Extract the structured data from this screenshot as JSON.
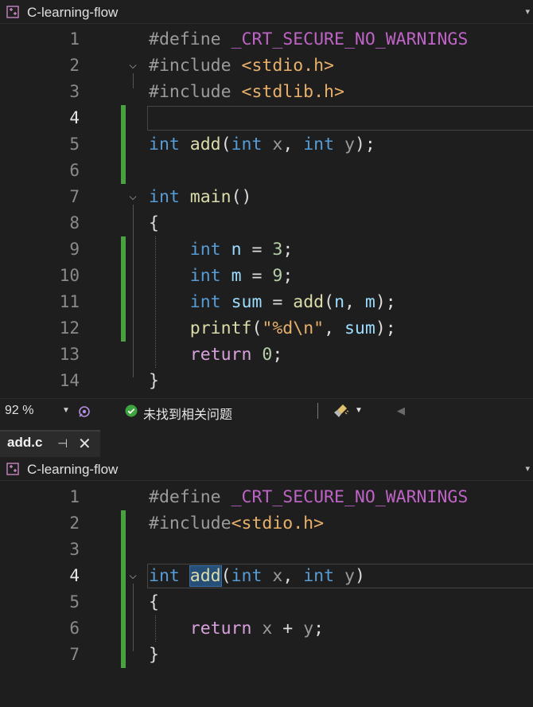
{
  "project": {
    "name": "C-learning-flow"
  },
  "editor1": {
    "lines": [
      {
        "n": "1",
        "tokens": [
          [
            "pp",
            "#define "
          ],
          [
            "mac",
            "_CRT_SECURE_NO_WARNINGS"
          ]
        ]
      },
      {
        "n": "2",
        "tokens": [
          [
            "pp",
            "#include "
          ],
          [
            "str",
            "<stdio.h>"
          ]
        ]
      },
      {
        "n": "3",
        "tokens": [
          [
            "pp",
            "#include "
          ],
          [
            "str",
            "<stdlib.h>"
          ]
        ]
      },
      {
        "n": "4",
        "tokens": []
      },
      {
        "n": "5",
        "tokens": [
          [
            "k",
            "int"
          ],
          [
            "pun",
            " "
          ],
          [
            "fn",
            "add"
          ],
          [
            "pun",
            "("
          ],
          [
            "k",
            "int"
          ],
          [
            "pun",
            " "
          ],
          [
            "prm",
            "x"
          ],
          [
            "pun",
            ", "
          ],
          [
            "k",
            "int"
          ],
          [
            "pun",
            " "
          ],
          [
            "prm",
            "y"
          ],
          [
            "pun",
            ");"
          ]
        ]
      },
      {
        "n": "6",
        "tokens": []
      },
      {
        "n": "7",
        "tokens": [
          [
            "k",
            "int"
          ],
          [
            "pun",
            " "
          ],
          [
            "fn",
            "main"
          ],
          [
            "pun",
            "()"
          ]
        ]
      },
      {
        "n": "8",
        "tokens": [
          [
            "pun",
            "{"
          ]
        ]
      },
      {
        "n": "9",
        "tokens": [
          [
            "pun",
            "    "
          ],
          [
            "k",
            "int"
          ],
          [
            "pun",
            " "
          ],
          [
            "var",
            "n"
          ],
          [
            "pun",
            " = "
          ],
          [
            "num",
            "3"
          ],
          [
            "pun",
            ";"
          ]
        ]
      },
      {
        "n": "10",
        "tokens": [
          [
            "pun",
            "    "
          ],
          [
            "k",
            "int"
          ],
          [
            "pun",
            " "
          ],
          [
            "var",
            "m"
          ],
          [
            "pun",
            " = "
          ],
          [
            "num",
            "9"
          ],
          [
            "pun",
            ";"
          ]
        ]
      },
      {
        "n": "11",
        "tokens": [
          [
            "pun",
            "    "
          ],
          [
            "k",
            "int"
          ],
          [
            "pun",
            " "
          ],
          [
            "var",
            "sum"
          ],
          [
            "pun",
            " = "
          ],
          [
            "fn",
            "add"
          ],
          [
            "pun",
            "("
          ],
          [
            "var",
            "n"
          ],
          [
            "pun",
            ", "
          ],
          [
            "var",
            "m"
          ],
          [
            "pun",
            ");"
          ]
        ]
      },
      {
        "n": "12",
        "tokens": [
          [
            "pun",
            "    "
          ],
          [
            "fn",
            "printf"
          ],
          [
            "pun",
            "("
          ],
          [
            "str",
            "\"%d"
          ],
          [
            "esc",
            "\\n"
          ],
          [
            "str",
            "\""
          ],
          [
            "pun",
            ", "
          ],
          [
            "var",
            "sum"
          ],
          [
            "pun",
            ");"
          ]
        ]
      },
      {
        "n": "13",
        "tokens": [
          [
            "pun",
            "    "
          ],
          [
            "ctl",
            "return"
          ],
          [
            "pun",
            " "
          ],
          [
            "num",
            "0"
          ],
          [
            "pun",
            ";"
          ]
        ]
      },
      {
        "n": "14",
        "tokens": [
          [
            "pun",
            "}"
          ]
        ]
      }
    ]
  },
  "status": {
    "zoom": "92 %",
    "issues": "未找到相关问题"
  },
  "tab": {
    "name": "add.c",
    "pin": "⊣",
    "close": "✕"
  },
  "editor2": {
    "lines": [
      {
        "n": "1",
        "tokens": [
          [
            "pp",
            "#define "
          ],
          [
            "mac",
            "_CRT_SECURE_NO_WARNINGS"
          ]
        ]
      },
      {
        "n": "2",
        "tokens": [
          [
            "pp",
            "#include"
          ],
          [
            "str",
            "<stdio.h>"
          ]
        ]
      },
      {
        "n": "3",
        "tokens": []
      },
      {
        "n": "4",
        "tokens": [
          [
            "k",
            "int"
          ],
          [
            "pun",
            " "
          ],
          [
            "fn sel",
            "add"
          ],
          [
            "pun",
            "("
          ],
          [
            "k",
            "int"
          ],
          [
            "pun",
            " "
          ],
          [
            "prm",
            "x"
          ],
          [
            "pun",
            ", "
          ],
          [
            "k",
            "int"
          ],
          [
            "pun",
            " "
          ],
          [
            "prm",
            "y"
          ],
          [
            "pun",
            ")"
          ]
        ]
      },
      {
        "n": "5",
        "tokens": [
          [
            "pun",
            "{"
          ]
        ]
      },
      {
        "n": "6",
        "tokens": [
          [
            "pun",
            "    "
          ],
          [
            "ctl",
            "return"
          ],
          [
            "pun",
            " "
          ],
          [
            "prm",
            "x"
          ],
          [
            "pun",
            " + "
          ],
          [
            "prm",
            "y"
          ],
          [
            "pun",
            ";"
          ]
        ]
      },
      {
        "n": "7",
        "tokens": [
          [
            "pun",
            "}"
          ]
        ]
      }
    ]
  },
  "colors": {
    "background": "#1e1e1e",
    "keyword": "#569cd6",
    "function": "#dcdcaa",
    "string": "#e8b06a",
    "macro": "#bd63c5",
    "change_marker": "#4aa13f"
  },
  "icons": [
    "project-icon",
    "dropdown-icon",
    "ai-assist-icon",
    "check-circle-icon",
    "cleanup-brush-icon",
    "arrow-left-icon",
    "pin-icon",
    "close-icon",
    "fold-chevron-icon"
  ]
}
